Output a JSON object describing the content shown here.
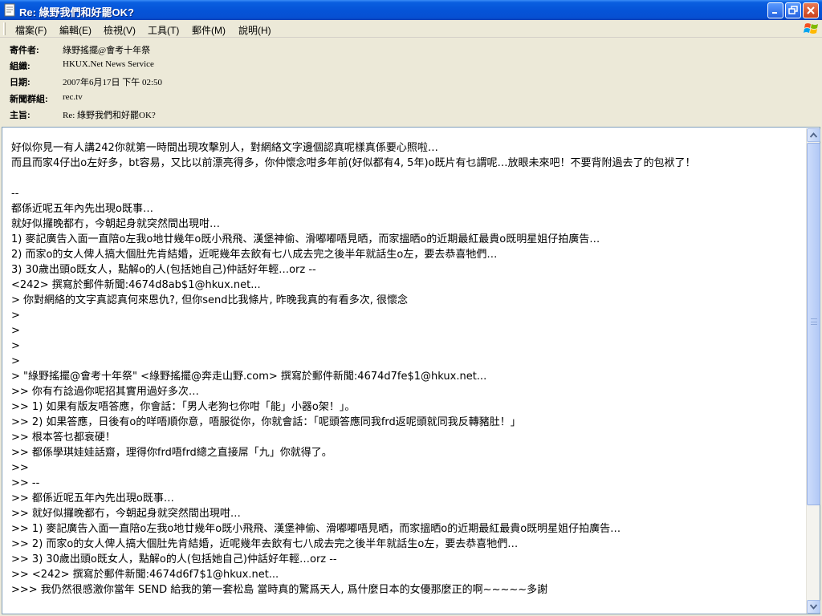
{
  "window": {
    "title": "Re: 綠野我們和好罷OK?"
  },
  "menu": [
    {
      "label": "檔案(F)"
    },
    {
      "label": "編輯(E)"
    },
    {
      "label": "檢視(V)"
    },
    {
      "label": "工具(T)"
    },
    {
      "label": "郵件(M)"
    },
    {
      "label": "說明(H)"
    }
  ],
  "headers": [
    {
      "label": "寄件者:",
      "value": "綠野搖擺@會考十年祭"
    },
    {
      "label": "組織:",
      "value": "HKUX.Net News Service"
    },
    {
      "label": "日期:",
      "value": "2007年6月17日 下午 02:50"
    },
    {
      "label": "新聞群組:",
      "value": "rec.tv"
    },
    {
      "label": "主旨:",
      "value": "Re: 綠野我們和好罷OK?"
    }
  ],
  "body": {
    "lines": [
      "好似你見一有人講242你就第一時間出現攻擊別人，對網絡文字邊個認真呢樣真係要心照啦…",
      "而且而家4仔出o左好多，bt容易，又比以前漂亮得多，你仲懷念咁多年前(好似都有4, 5年)o既片有乜謂呢…放眼未來吧！不要背附過去了的包袱了！",
      "",
      "--",
      "都係近呢五年內先出現o既事…",
      "就好似攞晚都冇，今朝起身就突然間出現咁…",
      "1) 麥記廣告入面一直陪o左我o地廿幾年o既小飛飛、漢堡神偷、滑嘟嘟唔見晒，而家搵晒o的近期最紅最貴o既明星姐仔拍廣告…",
      "2) 而家o的女人俾人搞大個肚先肯結婚，近呢幾年去飲有七八成去完之後半年就話生o左，要去恭喜牠們…",
      "3) 30歲出頭o既女人，點解o的人(包括她自己)仲話好年輕…orz --",
      "<242> 撰寫於郵件新聞:4674d8ab$1@hkux.net...",
      "> 你對網絡的文字真認真何來恩仇?, 但你send比我條片, 昨晚我真的有看多次, 很懷念",
      ">",
      ">",
      ">",
      ">",
      "> \"綠野搖擺@會考十年祭\" <綠野搖擺@奔走山野.com> 撰寫於郵件新聞:4674d7fe$1@hkux.net...",
      ">> 你有冇諗過你呢招其實用過好多次…",
      ">> 1) 如果有版友唔答應，你會話：「男人老狗乜你咁「能」小器o架！」。",
      ">> 2) 如果答應，日後有o的咩唔順你意，唔服從你，你就會話：「呢頭答應同我frd返呢頭就同我反轉豬肚！」",
      ">> 根本答乜都衰硬！",
      ">> 都係學琪娃娃話齋，理得你frd唔frd總之直接屌「九」你就得了。",
      ">>",
      ">> --",
      ">> 都係近呢五年內先出現o既事…",
      ">> 就好似攞晚都冇，今朝起身就突然間出現咁…",
      ">> 1) 麥記廣告入面一直陪o左我o地廿幾年o既小飛飛、漢堡神偷、滑嘟嘟唔見晒，而家搵晒o的近期最紅最貴o既明星姐仔拍廣告…",
      ">> 2) 而家o的女人俾人搞大個肚先肯結婚，近呢幾年去飲有七八成去完之後半年就話生o左，要去恭喜牠們…",
      ">> 3) 30歲出頭o既女人，點解o的人(包括她自己)仲話好年輕…orz --",
      ">> <242> 撰寫於郵件新聞:4674d6f7$1@hkux.net...",
      ">>> 我仍然很感激你當年 SEND 給我的第一套松島 當時真的驚爲天人, 爲什麼日本的女優那麼正的啊~~~~~多謝"
    ]
  },
  "colors": {
    "titlebar": "#0554d8",
    "chrome": "#ece9d8",
    "body_bg": "#ffffff",
    "border": "#7f9db9"
  },
  "icons": {
    "app": "document-icon",
    "minimize": "minimize-icon",
    "maximize": "restore-icon",
    "close": "close-icon",
    "logo": "windows-logo-icon"
  }
}
